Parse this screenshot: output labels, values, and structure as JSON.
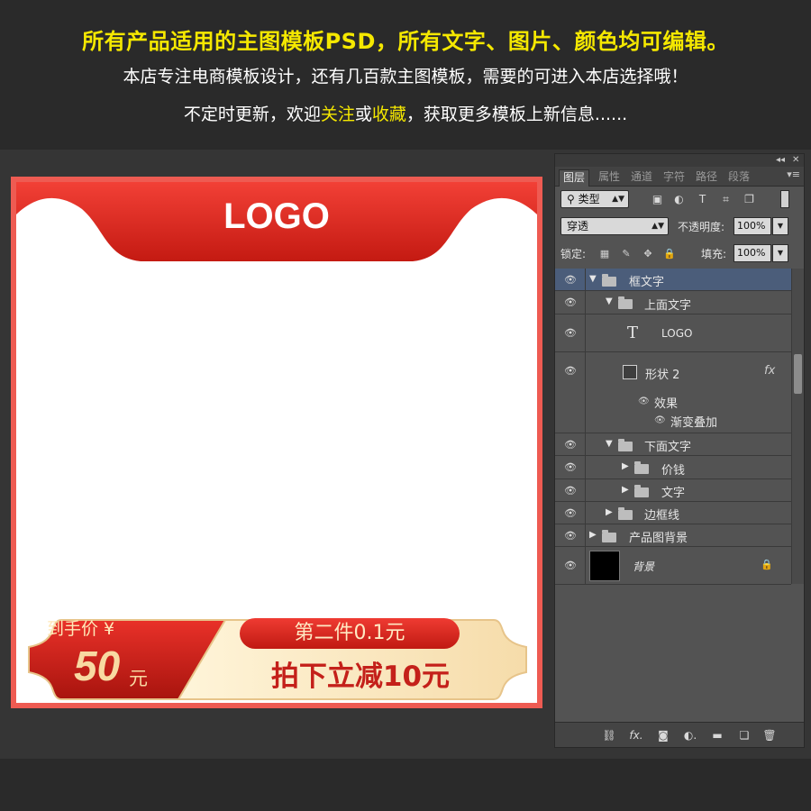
{
  "header": {
    "line1": "所有产品适用的主图模板PSD，所有文字、图片、颜色均可编辑。",
    "line2": "本店专注电商模板设计，还有几百款主图模板，需要的可进入本店选择哦！",
    "line3_a": "不定时更新，欢迎",
    "line3_follow": "关注",
    "line3_b": "或",
    "line3_collect": "收藏",
    "line3_c": "，获取更多模板上新信息......"
  },
  "template": {
    "logo": "LOGO",
    "price_label": "到手价 ¥",
    "price_value": "50",
    "price_unit": "元",
    "promo_pill": "第二件0.1元",
    "promo_main": "拍下立减10元",
    "colors": {
      "frame": "#ee5b52",
      "red_top": "#ef3b32",
      "red_dark": "#c01a12",
      "gold": "#f8d9a2"
    }
  },
  "ps_panel": {
    "titlebar": {
      "collapse": "◂◂",
      "close": "✕"
    },
    "tabs": [
      {
        "label": "图层",
        "active": true
      },
      {
        "label": "属性",
        "active": false
      },
      {
        "label": "通道",
        "active": false
      },
      {
        "label": "字符",
        "active": false
      },
      {
        "label": "路径",
        "active": false
      },
      {
        "label": "段落",
        "active": false
      }
    ],
    "tab_menu": "▾≡",
    "filter": {
      "kind_label": "类型",
      "icons": [
        "image-filter-icon",
        "adjustment-filter-icon",
        "type-filter-icon",
        "shape-filter-icon",
        "smart-object-filter-icon"
      ],
      "glyphs": [
        "▣",
        "◐",
        "T",
        "⌗",
        "❐"
      ]
    },
    "blend": {
      "mode": "穿透",
      "opacity_label": "不透明度:",
      "opacity": "100%"
    },
    "lock": {
      "label": "锁定:",
      "fill_label": "填充:",
      "fill": "100%",
      "glyphs": [
        "▦",
        "✎",
        "✥",
        "🔒"
      ]
    },
    "layers": [
      {
        "name": "框文字",
        "type": "group",
        "expanded": true,
        "selected": true,
        "depth": 0
      },
      {
        "name": "上面文字",
        "type": "group",
        "expanded": true,
        "depth": 1
      },
      {
        "name": "LOGO",
        "type": "text",
        "depth": 2
      },
      {
        "name": "形状 2",
        "type": "shape",
        "depth": 2,
        "fx": "fx",
        "effects_label": "效果",
        "effect": "渐变叠加"
      },
      {
        "name": "下面文字",
        "type": "group",
        "expanded": true,
        "depth": 1
      },
      {
        "name": "价钱",
        "type": "group",
        "expanded": false,
        "depth": 2
      },
      {
        "name": "文字",
        "type": "group",
        "expanded": false,
        "depth": 2
      },
      {
        "name": "边框线",
        "type": "group",
        "expanded": false,
        "depth": 1
      },
      {
        "name": "产品图背景",
        "type": "group",
        "expanded": false,
        "depth": 0
      },
      {
        "name": "背景",
        "type": "background",
        "locked": true,
        "depth": 0
      }
    ],
    "bottom_icons": [
      {
        "name": "link-layers-icon",
        "glyph": "⛓"
      },
      {
        "name": "fx-icon",
        "glyph": "fx."
      },
      {
        "name": "mask-icon",
        "glyph": "◙"
      },
      {
        "name": "adjustment-layer-icon",
        "glyph": "◐."
      },
      {
        "name": "new-group-icon",
        "glyph": "▬"
      },
      {
        "name": "new-layer-icon",
        "glyph": "❏"
      },
      {
        "name": "delete-layer-icon",
        "glyph": "🗑"
      }
    ]
  }
}
